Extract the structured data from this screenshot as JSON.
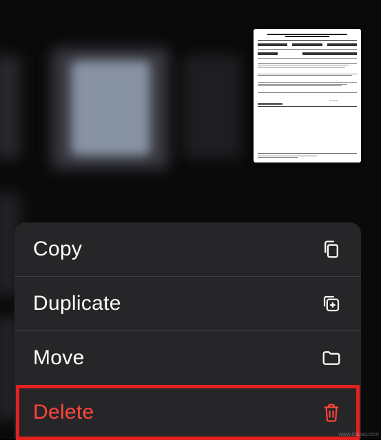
{
  "menu": {
    "copy": {
      "label": "Copy"
    },
    "duplicate": {
      "label": "Duplicate"
    },
    "move": {
      "label": "Move"
    },
    "delete": {
      "label": "Delete"
    }
  },
  "watermark": "www.deuaq.com",
  "colors": {
    "destructive": "#ff453a",
    "highlight": "#e22020",
    "menu_bg": "#262628"
  }
}
